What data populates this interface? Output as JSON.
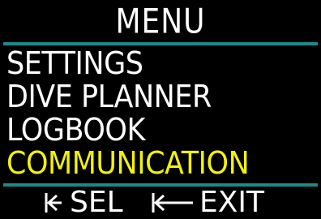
{
  "header": {
    "title": "MENU"
  },
  "menu": {
    "items": [
      {
        "label": "SETTINGS",
        "selected": false
      },
      {
        "label": "DIVE PLANNER",
        "selected": false
      },
      {
        "label": "LOGBOOK",
        "selected": false
      },
      {
        "label": "COMMUNICATION",
        "selected": true
      }
    ]
  },
  "footer": {
    "select_label": "SEL",
    "select_icon": "short-press-arrow-icon",
    "exit_label": "EXIT",
    "exit_icon": "long-press-arrow-icon"
  },
  "colors": {
    "background": "#000000",
    "text": "#ffffff",
    "selected": "#f2f20a",
    "divider": "#1a8a8a"
  }
}
